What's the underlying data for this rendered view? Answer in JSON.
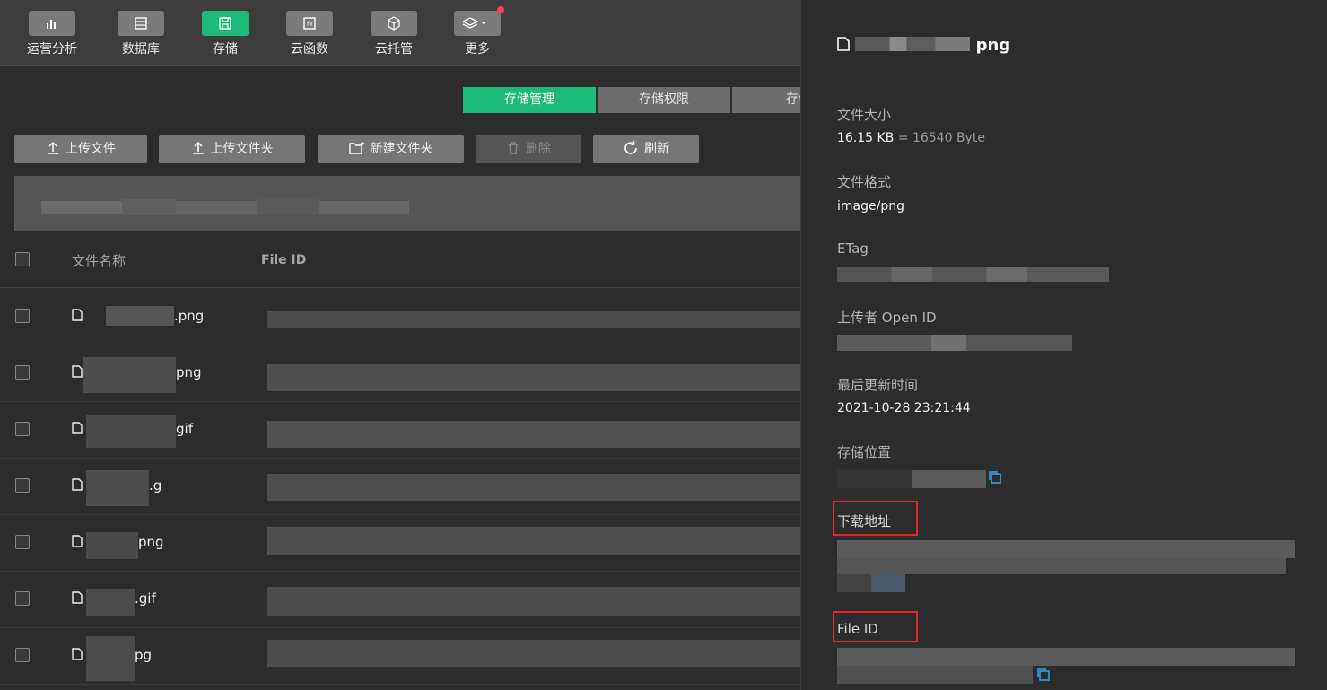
{
  "nav": {
    "items": [
      {
        "label": "运营分析",
        "icon": "bar-chart-icon"
      },
      {
        "label": "数据库",
        "icon": "database-icon"
      },
      {
        "label": "存储",
        "icon": "save-icon",
        "active": true
      },
      {
        "label": "云函数",
        "icon": "function-icon"
      },
      {
        "label": "云托管",
        "icon": "cube-icon"
      },
      {
        "label": "更多",
        "icon": "layers-icon",
        "has_badge": true
      }
    ]
  },
  "tabs": [
    "存储管理",
    "存储权限",
    "存储"
  ],
  "toolbar": {
    "upload_file": "上传文件",
    "upload_folder": "上传文件夹",
    "new_folder": "新建文件夹",
    "delete": "删除",
    "refresh": "刷新"
  },
  "table": {
    "col_name": "文件名称",
    "col_fileid": "File ID",
    "rows": [
      ".png",
      "png",
      "gif",
      ".g",
      "png",
      ".gif",
      "pg"
    ]
  },
  "panel": {
    "title_suffix": "png",
    "size_label": "文件大小",
    "size_value": "16.15 KB",
    "size_bytes": "= 16540 Byte",
    "format_label": "文件格式",
    "format_value": "image/png",
    "etag_label": "ETag",
    "uploader_label": "上传者 Open ID",
    "updated_label": "最后更新时间",
    "updated_value": "2021-10-28 23:21:44",
    "location_label": "存储位置",
    "download_label": "下载地址",
    "fileid_label": "File ID"
  },
  "colors": {
    "accent": "#1db978",
    "highlight": "#e3282c",
    "badge": "#f0484b",
    "link_icon": "#2ea6e6"
  }
}
